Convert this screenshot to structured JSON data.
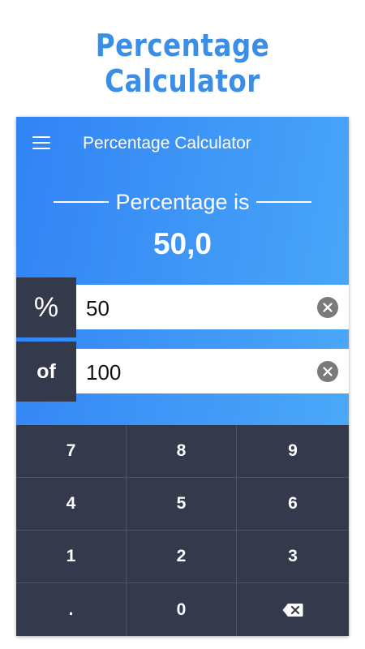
{
  "promo": {
    "title": "Percentage Calculator"
  },
  "appbar": {
    "title": "Percentage Calculator"
  },
  "result": {
    "label": "Percentage is",
    "value": "50,0"
  },
  "inputs": [
    {
      "label": "%",
      "value": "50"
    },
    {
      "label": "of",
      "value": "100"
    }
  ],
  "keypad": {
    "keys": [
      "7",
      "8",
      "9",
      "4",
      "5",
      "6",
      "1",
      "2",
      "3",
      ".",
      "0"
    ],
    "backspace_icon": "backspace-icon"
  },
  "colors": {
    "accent": "#3a8ee6",
    "gradient_start": "#3283f5",
    "gradient_end": "#4aa8f8",
    "dark_panel": "#343a4c",
    "clear_button": "#7a7a7a"
  }
}
